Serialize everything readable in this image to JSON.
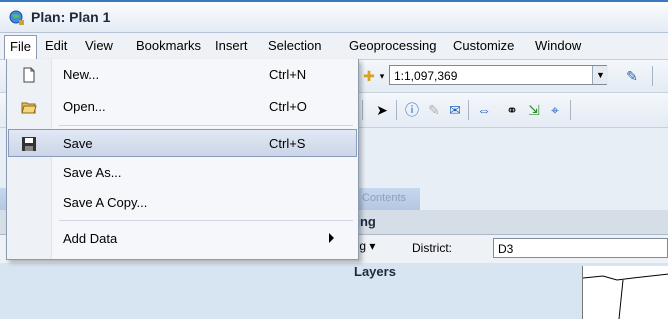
{
  "window": {
    "title": "Plan: Plan 1"
  },
  "menubar": [
    "File",
    "Edit",
    "View",
    "Bookmarks",
    "Insert",
    "Selection",
    "Geoprocessing",
    "Customize",
    "Window"
  ],
  "toolbar": {
    "scale": "1:1,097,369"
  },
  "panels": {
    "toc_title": "Contents",
    "editing_label": "ting",
    "dropdown_label": "ing",
    "district_label": "District:",
    "district_value": "D3",
    "layers_label": "Layers"
  },
  "file_menu": {
    "items": [
      {
        "label": "New...",
        "shortcut": "Ctrl+N",
        "icon": "new-document-icon"
      },
      {
        "label": "Open...",
        "shortcut": "Ctrl+O",
        "icon": "open-folder-icon"
      },
      {
        "label": "Save",
        "shortcut": "Ctrl+S",
        "icon": "save-disk-icon",
        "highlighted": true
      },
      {
        "label": "Save As...",
        "shortcut": ""
      },
      {
        "label": "Save A Copy...",
        "shortcut": ""
      },
      {
        "label": "Add Data",
        "shortcut": "",
        "submenu": true
      }
    ]
  }
}
